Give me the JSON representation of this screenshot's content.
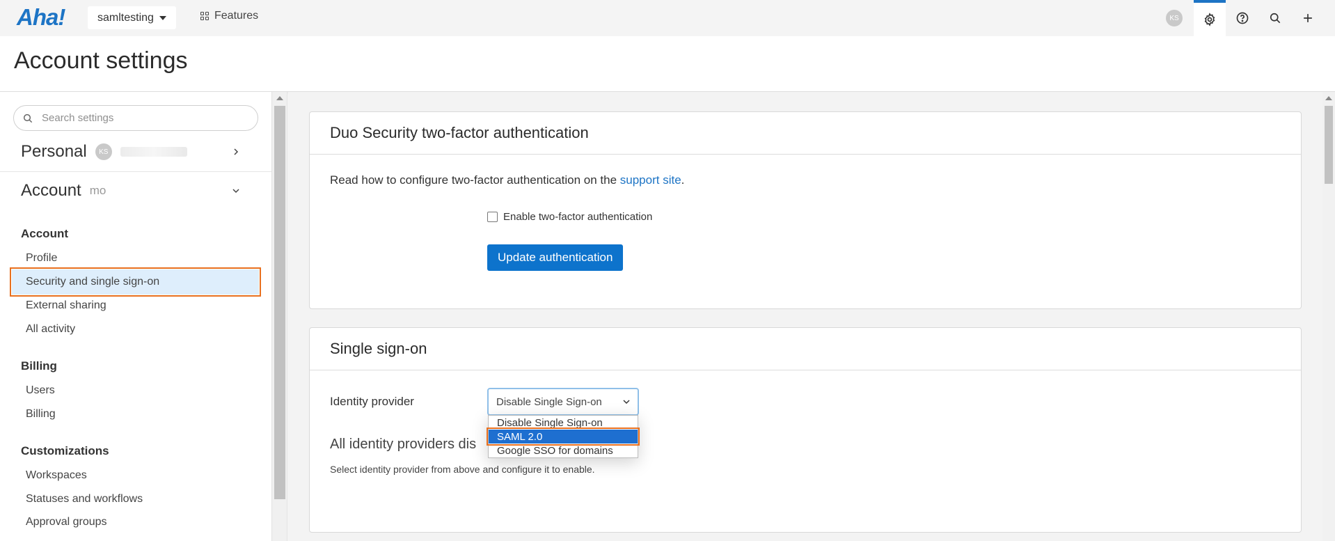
{
  "topbar": {
    "logo": "Aha!",
    "workspace": "samltesting",
    "features_label": "Features",
    "user_initials": "KS"
  },
  "header": {
    "title": "Account settings"
  },
  "sidebar": {
    "search_placeholder": "Search settings",
    "personal_label": "Personal",
    "personal_initials": "KS",
    "account_label": "Account",
    "account_sub": "mo",
    "groups": [
      {
        "title": "Account",
        "items": [
          "Profile",
          "Security and single sign-on",
          "External sharing",
          "All activity"
        ]
      },
      {
        "title": "Billing",
        "items": [
          "Users",
          "Billing"
        ]
      },
      {
        "title": "Customizations",
        "items": [
          "Workspaces",
          "Statuses and workflows",
          "Approval groups"
        ]
      }
    ],
    "selected_item": "Security and single sign-on"
  },
  "duo": {
    "title": "Duo Security two-factor authentication",
    "info_prefix": "Read how to configure two-factor authentication on the ",
    "info_link": "support site",
    "info_suffix": ".",
    "checkbox_label": "Enable two-factor authentication",
    "checkbox_checked": false,
    "button_label": "Update authentication"
  },
  "sso": {
    "title": "Single sign-on",
    "identity_label": "Identity provider",
    "selected_value": "Disable Single Sign-on",
    "options": [
      "Disable Single Sign-on",
      "SAML 2.0",
      "Google SSO for domains"
    ],
    "highlighted_option": "SAML 2.0",
    "all_providers_text": "All identity providers dis",
    "help_text": "Select identity provider from above and configure it to enable."
  },
  "colors": {
    "brand": "#1d74c5",
    "button": "#0d73cc",
    "highlight_outline": "#e8701f",
    "selected_bg": "#deeefc"
  }
}
